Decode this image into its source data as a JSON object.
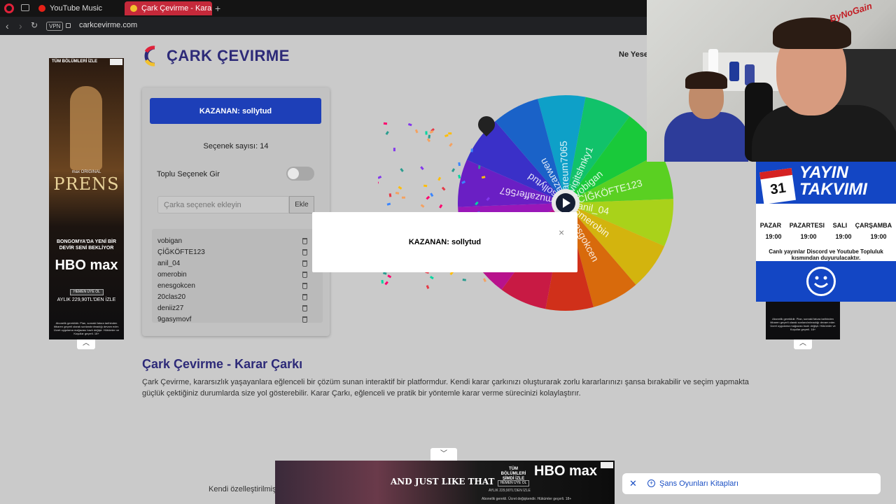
{
  "browser": {
    "tabs": [
      {
        "label": "YouTube Music",
        "active": false
      },
      {
        "label": "Çark Çevirme - Karar Çarkı",
        "active": true
      }
    ],
    "url": "carkcevirme.com",
    "vpn_label": "VPN"
  },
  "site": {
    "title": "ÇARK ÇEVIRME",
    "nav_link": "Ne Yesem"
  },
  "left_ad": {
    "top_text": "TÜM BÖLÜMLERİ İZLE",
    "original_label": "max ORIGINAL",
    "show_title": "PRENS",
    "slogan": "BONGOMYA'DA YENİ BİR DEVİR SENİ BEKLİYOR",
    "brand": "HBO max",
    "button": "HEMEN ÜYE OL",
    "price": "AYLIK 229,90TL'DEN İZLE",
    "fine_print": "Abonelik gereklidir. Plan, sonraki fatura tarihinden itibaren geçerli olarak sonlandırılmadığı devam eder. Ücret uygulama mağazası bazlı değişir. Hükümler ve Koşullar geçerli. 18+"
  },
  "panel": {
    "winner_button": "KAZANAN: sollytud",
    "option_count": "Seçenek sayısı: 14",
    "bulk_label": "Toplu Seçenek Gir",
    "bulk_toggle_on": false,
    "input_placeholder": "Çarka seçenek ekleyin",
    "add_button": "Ekle",
    "options": [
      "vobigan",
      "ÇİĞKÖFTE123",
      "anil_04",
      "omerobin",
      "enesgokcen",
      "20clas20",
      "deniiz27",
      "9gasymovf"
    ]
  },
  "wheel": {
    "segments": [
      {
        "label": "areum7065",
        "color": "#0ea0c8"
      },
      {
        "label": "yigitshnky1",
        "color": "#11c26a"
      },
      {
        "label": "vobigan",
        "color": "#19c93a"
      },
      {
        "label": "ÇİĞKÖFTE123",
        "color": "#5ad022"
      },
      {
        "label": "anil_04",
        "color": "#a9d21a"
      },
      {
        "label": "omerobin",
        "color": "#d3b40e"
      },
      {
        "label": "enesgokcen",
        "color": "#d86a0c"
      },
      {
        "label": "",
        "color": "#d0301a"
      },
      {
        "label": "",
        "color": "#c81a44"
      },
      {
        "label": "",
        "color": "#b8128c"
      },
      {
        "label": "",
        "color": "#9a17b8"
      },
      {
        "label": "muzaffer567",
        "color": "#6a1fc4"
      },
      {
        "label": "sollytud",
        "color": "#3a30c8"
      },
      {
        "label": "azarwen",
        "color": "#1a62c8"
      }
    ]
  },
  "modal": {
    "text": "KAZANAN: sollytud",
    "close": "×"
  },
  "content": {
    "heading": "Çark Çevirme - Karar Çarkı",
    "paragraph": "Çark Çevirme, kararsızlık yaşayanlara eğlenceli bir çözüm sunan interaktif bir platformdur. Kendi karar çarkınızı oluşturarak zorlu kararlarınızı şansa bırakabilir ve seçim yapmakta güçlük çektiğiniz durumlarda size yol gösterebilir. Karar Çarkı, eğlenceli ve pratik bir yöntemle karar verme sürecinizi kolaylaştırır.",
    "footer_text": "Kendi özelleştirilmiş"
  },
  "bottom_ad": {
    "show": "AND JUST LIKE THAT",
    "top_text": "TÜM BÖLÜMLERİ ŞİMDİ İZLE",
    "brand": "HBO max",
    "button": "HEMEN ÜYE OL",
    "price": "AYLIK 229,90TL'DEN İZLE",
    "fine": "Abonelik gerekli. Ücret değişkendir. Hükümler geçerli. 18+"
  },
  "toast": {
    "label": "Şans Oyunları Kitapları"
  },
  "stream": {
    "logo": "ByNoGain",
    "schedule_title": "YAYIN TAKVIMI",
    "calendar_day": "31",
    "days": [
      "PAZAR",
      "PAZARTESI",
      "SALI",
      "ÇARŞAMBA"
    ],
    "times": [
      "19:00",
      "19:00",
      "19:00",
      "19:00"
    ],
    "note": "Canlı yayınlar Discord ve Youtube Topluluk kısmından duyurulacaktır."
  },
  "right_ad": {
    "fine_print": "Abonelik gereklidir. Plan, sonraki fatura tarihinden itibaren geçerli olarak sonlandırılmadığı devam eder. Ücret uygulama mağazası bazlı değişir. Hükümler ve Koşullar geçerli. 18+"
  }
}
